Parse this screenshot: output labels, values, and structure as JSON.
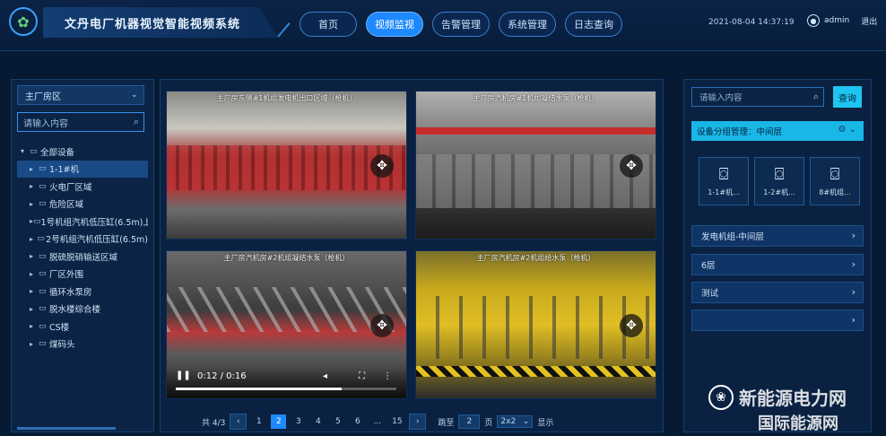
{
  "app": {
    "title": "文丹电厂机器视觉智能视频系统",
    "logo_icon": "gear-leaf-icon"
  },
  "nav": [
    {
      "label": "首页",
      "active": false
    },
    {
      "label": "视频监视",
      "active": true
    },
    {
      "label": "告警管理",
      "active": false
    },
    {
      "label": "系统管理",
      "active": false
    },
    {
      "label": "日志查询",
      "active": false
    }
  ],
  "header": {
    "datetime": "2021-08-04 14:37:19",
    "user": "admin",
    "logout": "退出"
  },
  "left": {
    "select_value": "主厂房区",
    "search_placeholder": "请输入内容",
    "tree": [
      {
        "label": "全部设备",
        "level": "root",
        "selected": false
      },
      {
        "label": "1-1#机",
        "level": "child",
        "selected": true
      },
      {
        "label": "火电厂区域",
        "level": "child",
        "selected": false
      },
      {
        "label": "危险区域",
        "level": "child",
        "selected": false
      },
      {
        "label": "1号机组汽机低压缸(6.5m)上",
        "level": "child",
        "selected": false
      },
      {
        "label": "2号机组汽机低压缸(6.5m)",
        "level": "child",
        "selected": false
      },
      {
        "label": "脱硫脱硝输送区域",
        "level": "child",
        "selected": false
      },
      {
        "label": "厂区外围",
        "level": "child",
        "selected": false
      },
      {
        "label": "循环水泵房",
        "level": "child",
        "selected": false
      },
      {
        "label": "脱水楼综合楼",
        "level": "child",
        "selected": false
      },
      {
        "label": "CS楼",
        "level": "child",
        "selected": false
      },
      {
        "label": "煤码头",
        "level": "child",
        "selected": false
      }
    ]
  },
  "videos": [
    {
      "title": "主厂房东侧#1机组发电机出口区域（枪机）"
    },
    {
      "title": "主厂房汽机房#1机组凝结水泵（枪机）"
    },
    {
      "title": "主厂房汽机房#2机组凝结水泵（枪机）",
      "time": "0:12 / 0:16",
      "progress": 0.75
    },
    {
      "title": "主厂房汽机房#2机组给水泵（枪机）"
    }
  ],
  "pager": {
    "total": "共 4/3",
    "pages": [
      "1",
      "2",
      "3",
      "4",
      "5",
      "6",
      "...",
      "15"
    ],
    "active_page": "2",
    "goto_label": "跳至",
    "goto_value": "2",
    "goto_unit": "页",
    "page_size": "2x2",
    "display_label": "显示"
  },
  "right": {
    "search_placeholder": "请输入内容",
    "query_label": "查询",
    "group_title": "设备分组管理：中间层",
    "cameras": [
      {
        "label": "1-1#机..."
      },
      {
        "label": "1-2#机..."
      },
      {
        "label": "8#机组..."
      }
    ],
    "groups": [
      {
        "label": "发电机组-中间层"
      },
      {
        "label": "6层"
      },
      {
        "label": "测试"
      },
      {
        "label": ""
      }
    ]
  },
  "watermark": {
    "brand": "新能源电力网",
    "brand_sub": "国际能源网"
  }
}
